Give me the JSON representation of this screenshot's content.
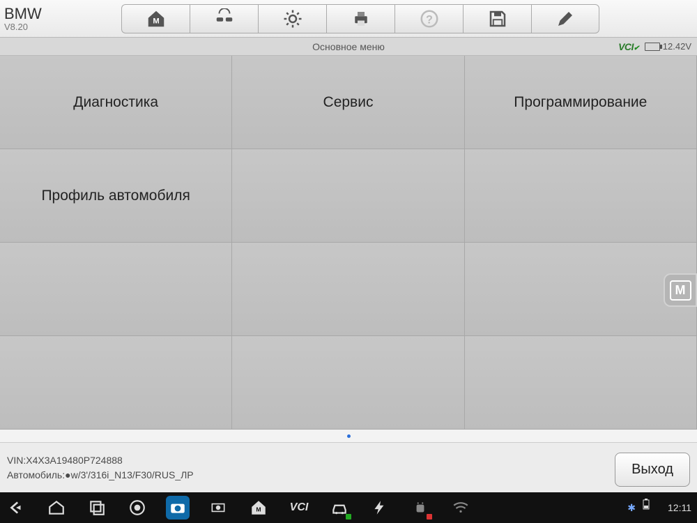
{
  "vehicle": {
    "make": "BMW",
    "version": "V8.20"
  },
  "subheader": {
    "title": "Основное меню",
    "vci": "VCI",
    "voltage": "12.42V"
  },
  "menu": {
    "items": [
      "Диагностика",
      "Сервис",
      "Программирование",
      "Профиль автомобиля"
    ]
  },
  "footer": {
    "vin_label": "VIN:",
    "vin_value": "X4X3A19480P724888",
    "vehicle_label": "Автомобиль:",
    "vehicle_value": "●w/3'/316i_N13/F30/RUS_ЛР",
    "exit": "Выход"
  },
  "sysbar": {
    "clock": "12:11"
  },
  "float_badge": "M"
}
